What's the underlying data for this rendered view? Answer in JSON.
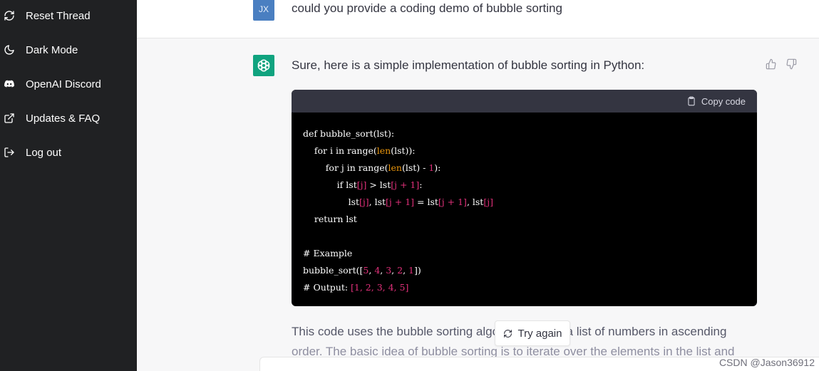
{
  "sidebar": {
    "items": [
      {
        "label": "Reset Thread",
        "icon": "refresh-icon"
      },
      {
        "label": "Dark Mode",
        "icon": "moon-icon"
      },
      {
        "label": "OpenAI Discord",
        "icon": "discord-icon"
      },
      {
        "label": "Updates & FAQ",
        "icon": "external-link-icon"
      },
      {
        "label": "Log out",
        "icon": "logout-icon"
      }
    ]
  },
  "user_message": {
    "avatar_initials": "JX",
    "text": "could you provide a coding demo of bubble sorting"
  },
  "bot_message": {
    "intro": "Sure, here is a simple implementation of bubble sorting in Python:",
    "copy_label": "Copy code",
    "explanation_line1": "This code uses the bubble sorting algorithm to sort a list of numbers in ascending",
    "explanation_line2": "order. The basic idea of bubble sorting is to iterate over the elements in the list and"
  },
  "code": {
    "lines": [
      [
        {
          "t": "def bubble_sort(lst):",
          "c": "tk-c"
        }
      ],
      [
        {
          "t": "    for i in range(",
          "c": "tk-c"
        },
        {
          "t": "len",
          "c": "tk-b"
        },
        {
          "t": "(lst)):",
          "c": "tk-c"
        }
      ],
      [
        {
          "t": "        for j in range(",
          "c": "tk-c"
        },
        {
          "t": "len",
          "c": "tk-b"
        },
        {
          "t": "(lst) - ",
          "c": "tk-c"
        },
        {
          "t": "1",
          "c": "tk-n"
        },
        {
          "t": "):",
          "c": "tk-c"
        }
      ],
      [
        {
          "t": "            if lst",
          "c": "tk-c"
        },
        {
          "t": "[j]",
          "c": "tk-n"
        },
        {
          "t": " > lst",
          "c": "tk-c"
        },
        {
          "t": "[j + 1]",
          "c": "tk-n"
        },
        {
          "t": ":",
          "c": "tk-c"
        }
      ],
      [
        {
          "t": "                lst",
          "c": "tk-c"
        },
        {
          "t": "[j]",
          "c": "tk-n"
        },
        {
          "t": ", lst",
          "c": "tk-c"
        },
        {
          "t": "[j + 1]",
          "c": "tk-n"
        },
        {
          "t": " = lst",
          "c": "tk-c"
        },
        {
          "t": "[j + 1]",
          "c": "tk-n"
        },
        {
          "t": ", lst",
          "c": "tk-c"
        },
        {
          "t": "[j]",
          "c": "tk-n"
        }
      ],
      [
        {
          "t": "    return lst",
          "c": "tk-c"
        }
      ],
      [
        {
          "t": "",
          "c": "tk-c"
        }
      ],
      [
        {
          "t": "# Example",
          "c": "tk-c"
        }
      ],
      [
        {
          "t": "bubble_sort([",
          "c": "tk-c"
        },
        {
          "t": "5",
          "c": "tk-n"
        },
        {
          "t": ", ",
          "c": "tk-c"
        },
        {
          "t": "4",
          "c": "tk-n"
        },
        {
          "t": ", ",
          "c": "tk-c"
        },
        {
          "t": "3",
          "c": "tk-n"
        },
        {
          "t": ", ",
          "c": "tk-c"
        },
        {
          "t": "2",
          "c": "tk-n"
        },
        {
          "t": ", ",
          "c": "tk-c"
        },
        {
          "t": "1",
          "c": "tk-n"
        },
        {
          "t": "])",
          "c": "tk-c"
        }
      ],
      [
        {
          "t": "# Output: ",
          "c": "tk-c"
        },
        {
          "t": "[1, 2, 3, 4, 5]",
          "c": "tk-n"
        }
      ]
    ]
  },
  "try_again_label": "Try again",
  "watermark": "CSDN @Jason36912",
  "colors": {
    "sidebar_bg": "#202123",
    "bot_avatar": "#10a37f",
    "user_avatar": "#4a7fc1",
    "code_bg": "#000000",
    "code_number": "#df3079",
    "code_builtin": "#e9950c"
  }
}
